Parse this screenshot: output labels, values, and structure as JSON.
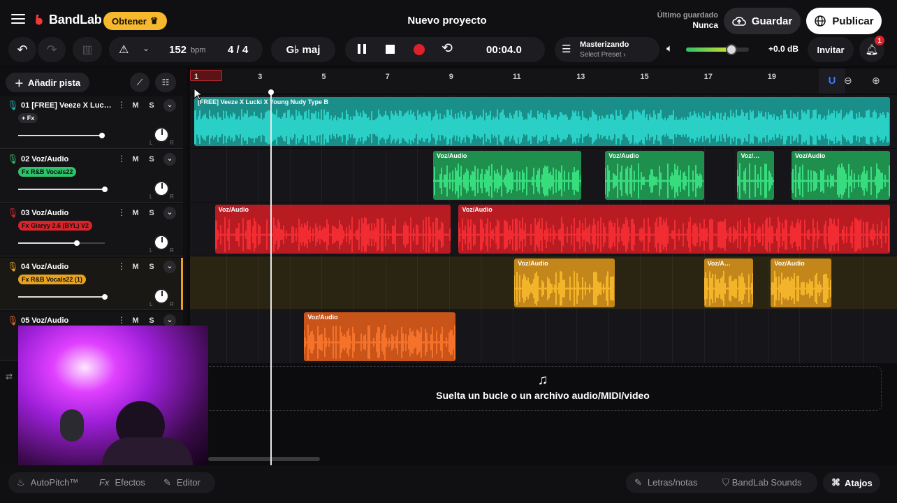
{
  "header": {
    "brand": "BandLab",
    "get_label": "Obtener",
    "project_title": "Nuevo proyecto",
    "last_saved_label": "Último guardado",
    "last_saved_value": "Nunca",
    "save_label": "Guardar",
    "publish_label": "Publicar"
  },
  "transport": {
    "tempo": "152",
    "tempo_unit": "bpm",
    "time_signature": "4 / 4",
    "key": "G♭ maj",
    "time": "00:04.0",
    "mastering_title": "Masterizando",
    "mastering_preset": "Select Preset ›",
    "volume_db": "+0.0 dB",
    "volume_level": 0.72,
    "invite_label": "Invitar",
    "notifications_count": "1"
  },
  "toolbar": {
    "add_track_label": "Añadir pista"
  },
  "timeline": {
    "bars": [
      "1",
      "3",
      "5",
      "7",
      "9",
      "11",
      "13",
      "15",
      "17",
      "19"
    ],
    "playhead_bar": 3.4
  },
  "tracks": [
    {
      "name": "01  [FREE] Veeze X Luc…",
      "fx": "+ Fx",
      "color": "#1fb5ad",
      "volume": 0.6
    },
    {
      "name": "02  Voz/Audio",
      "fx": "Fx  R&B Vocals22",
      "color": "#2ec26a",
      "volume": 0.62
    },
    {
      "name": "03  Voz/Audio",
      "fx": "Fx  Glaryy 2.6 (BYL) V2",
      "color": "#d8242a",
      "volume": 0.42
    },
    {
      "name": "04  Voz/Audio",
      "fx": "Fx  R&B Vocals22 (1)",
      "color": "#e8a21e",
      "volume": 0.62
    },
    {
      "name": "05  Voz/Audio",
      "fx": "",
      "color": "#e8651e",
      "volume": 0.5
    }
  ],
  "clips": {
    "track1": "[FREE] Veeze X Lucki X Young Nudy Type B",
    "vox": "Voz/Audio",
    "vox_short": "Voz/…",
    "vox_short2": "Voz/A…"
  },
  "drop_zone": {
    "text": "Suelta un bucle o un archivo audio/MIDI/video"
  },
  "bottom": {
    "autopitch": "AutoPitch™",
    "effects": "Efectos",
    "editor": "Editor",
    "lyrics": "Letras/notas",
    "sounds": "BandLab Sounds",
    "shortcuts": "Atajos"
  },
  "colors": {
    "teal": "#1fb5ad",
    "green": "#2ec26a",
    "red": "#d8242a",
    "yellow": "#e8a21e",
    "orange": "#e8651e",
    "brand_red": "#f03a3a"
  }
}
